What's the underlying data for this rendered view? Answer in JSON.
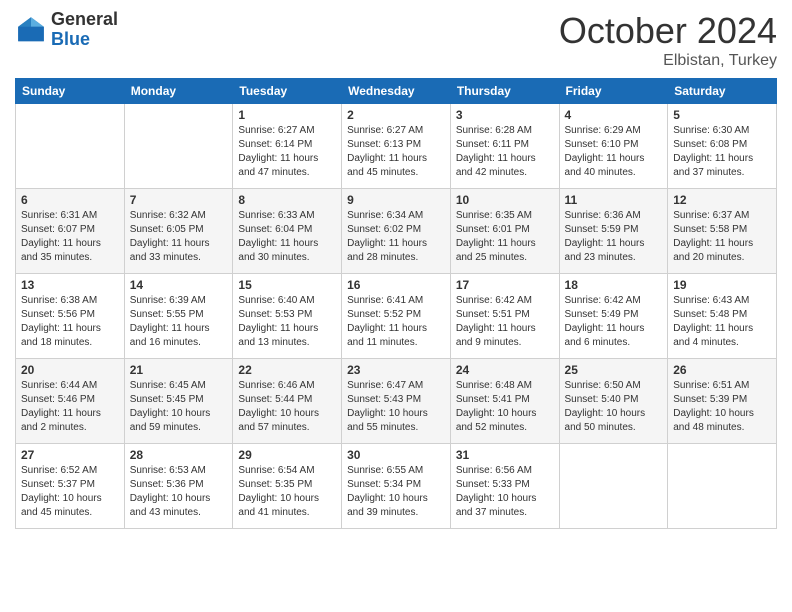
{
  "header": {
    "logo_general": "General",
    "logo_blue": "Blue",
    "month": "October 2024",
    "location": "Elbistan, Turkey"
  },
  "days_of_week": [
    "Sunday",
    "Monday",
    "Tuesday",
    "Wednesday",
    "Thursday",
    "Friday",
    "Saturday"
  ],
  "weeks": [
    [
      {
        "day": "",
        "info": ""
      },
      {
        "day": "",
        "info": ""
      },
      {
        "day": "1",
        "info": "Sunrise: 6:27 AM\nSunset: 6:14 PM\nDaylight: 11 hours and 47 minutes."
      },
      {
        "day": "2",
        "info": "Sunrise: 6:27 AM\nSunset: 6:13 PM\nDaylight: 11 hours and 45 minutes."
      },
      {
        "day": "3",
        "info": "Sunrise: 6:28 AM\nSunset: 6:11 PM\nDaylight: 11 hours and 42 minutes."
      },
      {
        "day": "4",
        "info": "Sunrise: 6:29 AM\nSunset: 6:10 PM\nDaylight: 11 hours and 40 minutes."
      },
      {
        "day": "5",
        "info": "Sunrise: 6:30 AM\nSunset: 6:08 PM\nDaylight: 11 hours and 37 minutes."
      }
    ],
    [
      {
        "day": "6",
        "info": "Sunrise: 6:31 AM\nSunset: 6:07 PM\nDaylight: 11 hours and 35 minutes."
      },
      {
        "day": "7",
        "info": "Sunrise: 6:32 AM\nSunset: 6:05 PM\nDaylight: 11 hours and 33 minutes."
      },
      {
        "day": "8",
        "info": "Sunrise: 6:33 AM\nSunset: 6:04 PM\nDaylight: 11 hours and 30 minutes."
      },
      {
        "day": "9",
        "info": "Sunrise: 6:34 AM\nSunset: 6:02 PM\nDaylight: 11 hours and 28 minutes."
      },
      {
        "day": "10",
        "info": "Sunrise: 6:35 AM\nSunset: 6:01 PM\nDaylight: 11 hours and 25 minutes."
      },
      {
        "day": "11",
        "info": "Sunrise: 6:36 AM\nSunset: 5:59 PM\nDaylight: 11 hours and 23 minutes."
      },
      {
        "day": "12",
        "info": "Sunrise: 6:37 AM\nSunset: 5:58 PM\nDaylight: 11 hours and 20 minutes."
      }
    ],
    [
      {
        "day": "13",
        "info": "Sunrise: 6:38 AM\nSunset: 5:56 PM\nDaylight: 11 hours and 18 minutes."
      },
      {
        "day": "14",
        "info": "Sunrise: 6:39 AM\nSunset: 5:55 PM\nDaylight: 11 hours and 16 minutes."
      },
      {
        "day": "15",
        "info": "Sunrise: 6:40 AM\nSunset: 5:53 PM\nDaylight: 11 hours and 13 minutes."
      },
      {
        "day": "16",
        "info": "Sunrise: 6:41 AM\nSunset: 5:52 PM\nDaylight: 11 hours and 11 minutes."
      },
      {
        "day": "17",
        "info": "Sunrise: 6:42 AM\nSunset: 5:51 PM\nDaylight: 11 hours and 9 minutes."
      },
      {
        "day": "18",
        "info": "Sunrise: 6:42 AM\nSunset: 5:49 PM\nDaylight: 11 hours and 6 minutes."
      },
      {
        "day": "19",
        "info": "Sunrise: 6:43 AM\nSunset: 5:48 PM\nDaylight: 11 hours and 4 minutes."
      }
    ],
    [
      {
        "day": "20",
        "info": "Sunrise: 6:44 AM\nSunset: 5:46 PM\nDaylight: 11 hours and 2 minutes."
      },
      {
        "day": "21",
        "info": "Sunrise: 6:45 AM\nSunset: 5:45 PM\nDaylight: 10 hours and 59 minutes."
      },
      {
        "day": "22",
        "info": "Sunrise: 6:46 AM\nSunset: 5:44 PM\nDaylight: 10 hours and 57 minutes."
      },
      {
        "day": "23",
        "info": "Sunrise: 6:47 AM\nSunset: 5:43 PM\nDaylight: 10 hours and 55 minutes."
      },
      {
        "day": "24",
        "info": "Sunrise: 6:48 AM\nSunset: 5:41 PM\nDaylight: 10 hours and 52 minutes."
      },
      {
        "day": "25",
        "info": "Sunrise: 6:50 AM\nSunset: 5:40 PM\nDaylight: 10 hours and 50 minutes."
      },
      {
        "day": "26",
        "info": "Sunrise: 6:51 AM\nSunset: 5:39 PM\nDaylight: 10 hours and 48 minutes."
      }
    ],
    [
      {
        "day": "27",
        "info": "Sunrise: 6:52 AM\nSunset: 5:37 PM\nDaylight: 10 hours and 45 minutes."
      },
      {
        "day": "28",
        "info": "Sunrise: 6:53 AM\nSunset: 5:36 PM\nDaylight: 10 hours and 43 minutes."
      },
      {
        "day": "29",
        "info": "Sunrise: 6:54 AM\nSunset: 5:35 PM\nDaylight: 10 hours and 41 minutes."
      },
      {
        "day": "30",
        "info": "Sunrise: 6:55 AM\nSunset: 5:34 PM\nDaylight: 10 hours and 39 minutes."
      },
      {
        "day": "31",
        "info": "Sunrise: 6:56 AM\nSunset: 5:33 PM\nDaylight: 10 hours and 37 minutes."
      },
      {
        "day": "",
        "info": ""
      },
      {
        "day": "",
        "info": ""
      }
    ]
  ]
}
